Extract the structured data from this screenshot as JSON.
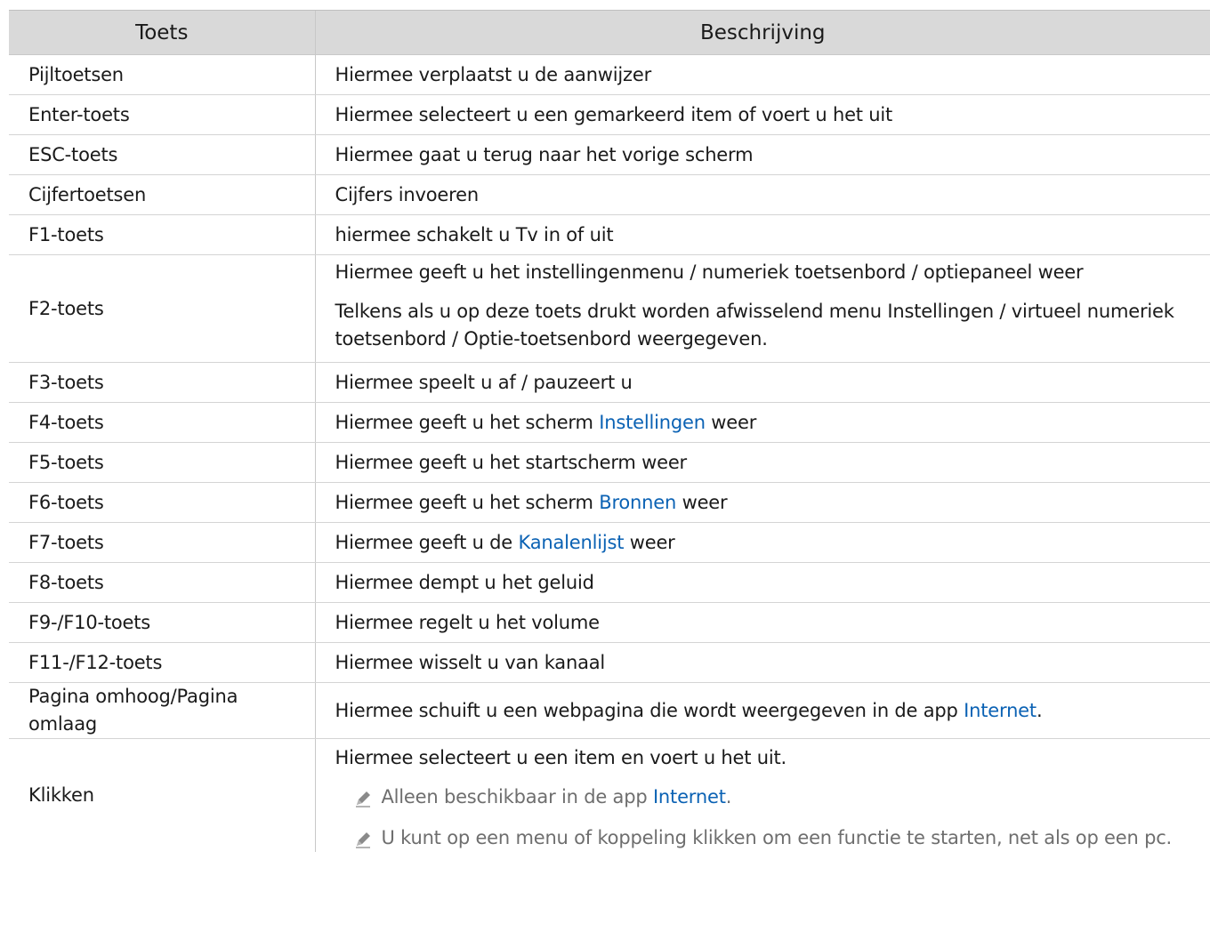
{
  "table": {
    "headers": [
      "Toets",
      "Beschrijving"
    ],
    "rows": [
      {
        "key": "Pijltoetsen",
        "desc": [
          {
            "parts": [
              "Hiermee verplaatst u de aanwijzer"
            ]
          }
        ]
      },
      {
        "key": "Enter-toets",
        "desc": [
          {
            "parts": [
              "Hiermee selecteert u een gemarkeerd item of voert u het uit"
            ]
          }
        ]
      },
      {
        "key": "ESC-toets",
        "desc": [
          {
            "parts": [
              "Hiermee gaat u terug naar het vorige scherm"
            ]
          }
        ]
      },
      {
        "key": "Cijfertoetsen",
        "desc": [
          {
            "parts": [
              "Cijfers invoeren"
            ]
          }
        ]
      },
      {
        "key": "F1-toets",
        "desc": [
          {
            "parts": [
              "hiermee schakelt u Tv in of uit"
            ]
          }
        ]
      },
      {
        "key": "F2-toets",
        "desc": [
          {
            "parts": [
              "Hiermee geeft u het instellingenmenu / numeriek toetsenbord / optiepaneel weer"
            ]
          },
          {
            "parts": [
              "Telkens als u op deze toets drukt worden afwisselend menu Instellingen / virtueel numeriek toetsenbord / Optie-toetsenbord weergegeven."
            ]
          }
        ]
      },
      {
        "key": "F3-toets",
        "desc": [
          {
            "parts": [
              "Hiermee speelt u af / pauzeert u"
            ]
          }
        ]
      },
      {
        "key": "F4-toets",
        "desc": [
          {
            "parts": [
              "Hiermee geeft u het scherm ",
              {
                "link": "Instellingen"
              },
              " weer"
            ]
          }
        ]
      },
      {
        "key": "F5-toets",
        "desc": [
          {
            "parts": [
              "Hiermee geeft u het startscherm weer"
            ]
          }
        ]
      },
      {
        "key": "F6-toets",
        "desc": [
          {
            "parts": [
              "Hiermee geeft u het scherm ",
              {
                "link": "Bronnen"
              },
              " weer"
            ]
          }
        ]
      },
      {
        "key": "F7-toets",
        "desc": [
          {
            "parts": [
              "Hiermee geeft u de ",
              {
                "link": "Kanalenlijst"
              },
              " weer"
            ]
          }
        ]
      },
      {
        "key": "F8-toets",
        "desc": [
          {
            "parts": [
              "Hiermee dempt u het geluid"
            ]
          }
        ]
      },
      {
        "key": "F9-/F10-toets",
        "desc": [
          {
            "parts": [
              "Hiermee regelt u het volume"
            ]
          }
        ]
      },
      {
        "key": "F11-/F12-toets",
        "desc": [
          {
            "parts": [
              "Hiermee wisselt u van kanaal"
            ]
          }
        ]
      },
      {
        "key": "Pagina omhoog/Pagina omlaag",
        "desc": [
          {
            "parts": [
              "Hiermee schuift u een webpagina die wordt weergegeven in de app ",
              {
                "link": "Internet"
              },
              "."
            ]
          }
        ]
      },
      {
        "key": "Klikken",
        "desc": [
          {
            "parts": [
              "Hiermee selecteert u een item en voert u het uit."
            ]
          },
          {
            "note": true,
            "icon": "pencil-icon",
            "parts": [
              "Alleen beschikbaar in de app ",
              {
                "link": "Internet"
              },
              "."
            ]
          },
          {
            "note": true,
            "icon": "pencil-icon",
            "parts": [
              "U kunt op een menu of koppeling klikken om een functie te starten, net als op een pc."
            ]
          }
        ]
      }
    ]
  },
  "colors": {
    "header_bg": "#d9d9d9",
    "link": "#0b62b4",
    "note_text": "#6e6e6e",
    "grid": "#d4d4d4"
  }
}
